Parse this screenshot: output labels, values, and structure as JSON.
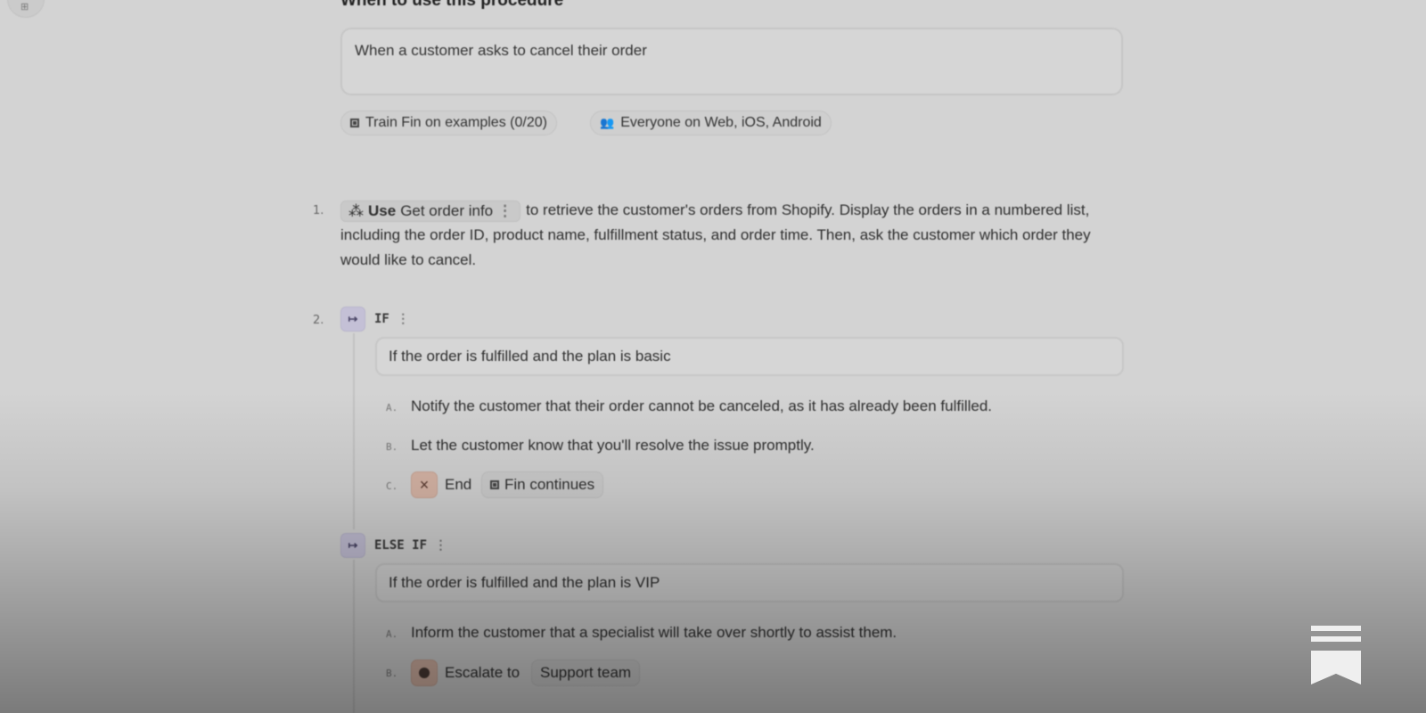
{
  "procedure": {
    "section_title": "When to use this procedure",
    "trigger_text": "When a customer asks to cancel their order",
    "chips": {
      "train": "Train Fin on examples (0/20)",
      "audience": "Everyone on Web, iOS, Android"
    }
  },
  "steps": {
    "step1": {
      "number": "1.",
      "use_label": "Use",
      "tool_name": "Get order info",
      "kebab": "⋮",
      "text": "to retrieve the customer's orders from Shopify. Display the orders in a numbered list, including the order ID, product name, fulfillment status, and order time. Then, ask the customer which order they would like to cancel."
    },
    "step2": {
      "number": "2.",
      "if_label": "IF",
      "kebab": "⋮",
      "if_condition": "If the order is fulfilled and the plan is basic",
      "if_substeps": {
        "a": {
          "marker": "A.",
          "text": "Notify the customer that their order cannot be canceled, as it has already been fulfilled."
        },
        "b": {
          "marker": "B.",
          "text": "Let the customer know that you'll resolve the issue promptly."
        },
        "c": {
          "marker": "C.",
          "end_icon": "×",
          "end_label": "End",
          "fin_label": "Fin continues"
        }
      },
      "elseif_label": "ELSE IF",
      "elseif_condition": "If the order is fulfilled and the plan is VIP",
      "elseif_substeps": {
        "a": {
          "marker": "A.",
          "text": "Inform the customer that a specialist will take over shortly to assist them."
        },
        "b": {
          "marker": "B.",
          "escalate_label": "Escalate to",
          "team": "Support team"
        }
      }
    }
  },
  "icons": {
    "branch": "↦",
    "people": "👥"
  },
  "colors": {
    "background": "#d3d3d3",
    "branch_icon": "#c4c0d6",
    "end_icon": "#d7b5a6",
    "bookmark": "#efefef"
  }
}
